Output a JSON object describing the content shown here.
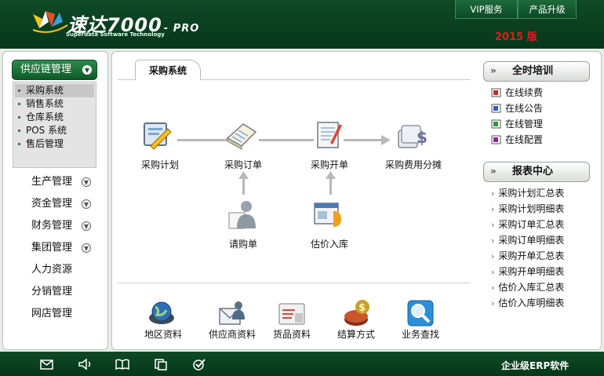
{
  "header": {
    "brand_name": "速达",
    "brand_number": "7000",
    "brand_edition": "- PRO",
    "brand_subtitle": "Superdata Software Technology",
    "vip_label": "VIP服务",
    "upgrade_label": "产品升级",
    "version_label": "2015 版"
  },
  "left_nav": {
    "section_label": "供应链管理",
    "submenu": [
      "采购系统",
      "销售系统",
      "仓库系统",
      "POS 系统",
      "售后管理"
    ],
    "items": [
      {
        "label": "生产管理",
        "expandable": true
      },
      {
        "label": "资金管理",
        "expandable": true
      },
      {
        "label": "财务管理",
        "expandable": true
      },
      {
        "label": "集团管理",
        "expandable": true
      },
      {
        "label": "人力资源",
        "expandable": false
      },
      {
        "label": "分销管理",
        "expandable": false
      },
      {
        "label": "网店管理",
        "expandable": false
      }
    ]
  },
  "main": {
    "tab_label": "采购系统",
    "workflow": {
      "plan": "采购计划",
      "order": "采购订单",
      "invoice": "采购开单",
      "expense": "采购费用分摊",
      "requisition": "请购单",
      "estimate": "估价入库"
    },
    "shortcuts": [
      "地区资料",
      "供应商资料",
      "货品资料",
      "结算方式",
      "业务查找"
    ]
  },
  "right_sidebar": {
    "training_title": "全时培训",
    "training_links": [
      "在线续费",
      "在线公告",
      "在线管理",
      "在线配置"
    ],
    "report_title": "报表中心",
    "report_links": [
      "采购计划汇总表",
      "采购计划明细表",
      "采购订单汇总表",
      "采购订单明细表",
      "采购开单汇总表",
      "采购开单明细表",
      "估价入库汇总表",
      "估价入库明细表"
    ]
  },
  "footer": {
    "icons": [
      "mail-icon",
      "speaker-icon",
      "book-icon",
      "copy-icon",
      "check-icon"
    ],
    "tagline": "企业级ERP软件"
  },
  "colors": {
    "header_green": "#0f4a26",
    "version_red": "#e31d1d",
    "nav_green": "#2f8a4a"
  }
}
